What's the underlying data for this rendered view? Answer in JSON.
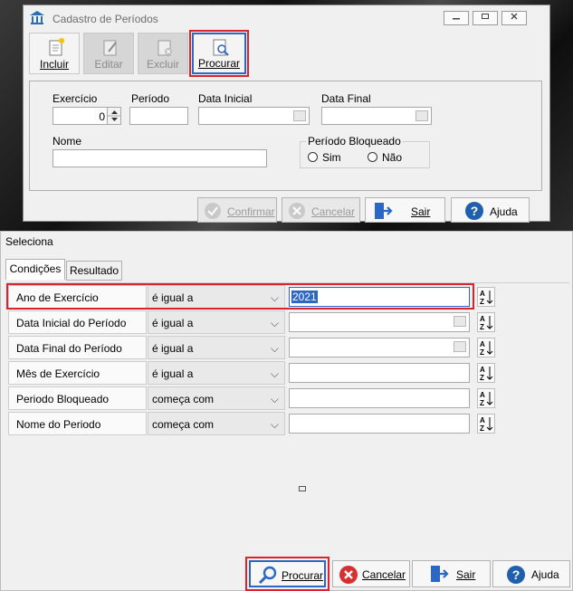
{
  "window1": {
    "title": "Cadastro de Períodos",
    "toolbar": {
      "incluir": "Incluir",
      "editar": "Editar",
      "excluir": "Excluir",
      "procurar": "Procurar"
    },
    "form": {
      "exercicio_label": "Exercício",
      "exercicio_value": "0",
      "periodo_label": "Período",
      "data_inicial_label": "Data Inicial",
      "data_final_label": "Data Final",
      "nome_label": "Nome",
      "bloqueado_label": "Período Bloqueado",
      "sim_label": "Sim",
      "nao_label": "Não"
    },
    "footer": {
      "confirmar": "Confirmar",
      "cancelar": "Cancelar",
      "sair": "Sair",
      "ajuda": "Ajuda"
    }
  },
  "window2": {
    "title": "Seleciona",
    "tabs": [
      "Condições",
      "Resultado"
    ],
    "rows": [
      {
        "name": "Ano de Exercício",
        "op": "é igual a",
        "value": "2021"
      },
      {
        "name": "Data Inicial do Período",
        "op": "é igual a",
        "value": ""
      },
      {
        "name": "Data Final do Período",
        "op": "é igual a",
        "value": ""
      },
      {
        "name": "Mês de Exercício",
        "op": "é igual a",
        "value": ""
      },
      {
        "name": "Periodo Bloqueado",
        "op": "começa com",
        "value": ""
      },
      {
        "name": "Nome do Periodo",
        "op": "começa com",
        "value": ""
      }
    ],
    "footer": {
      "procurar": "Procurar",
      "cancelar": "Cancelar",
      "sair": "Sair",
      "ajuda": "Ajuda"
    }
  },
  "colors": {
    "highlight": "#d9232d",
    "accent_blue": "#2b67c3",
    "help_blue": "#1f5fae",
    "cancel_red": "#d83030"
  }
}
